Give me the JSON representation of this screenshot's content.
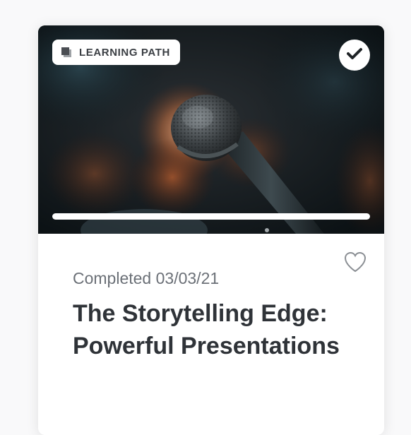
{
  "card": {
    "type_badge": {
      "label": "LEARNING PATH",
      "icon": "layers-icon"
    },
    "completed_icon": "check-icon",
    "progress": {
      "value": 1.0
    },
    "favorite_icon": "heart-outline-icon",
    "status_text": "Completed 03/03/21",
    "title": "The Storytelling Edge: Powerful Presentations",
    "hero_image": "microphone-photo"
  },
  "colors": {
    "title": "#2f3338",
    "status": "#6b7077",
    "badge_text": "#3b3f44",
    "hero_dark": "#0e1519",
    "progress_fill": "#ffffff"
  }
}
